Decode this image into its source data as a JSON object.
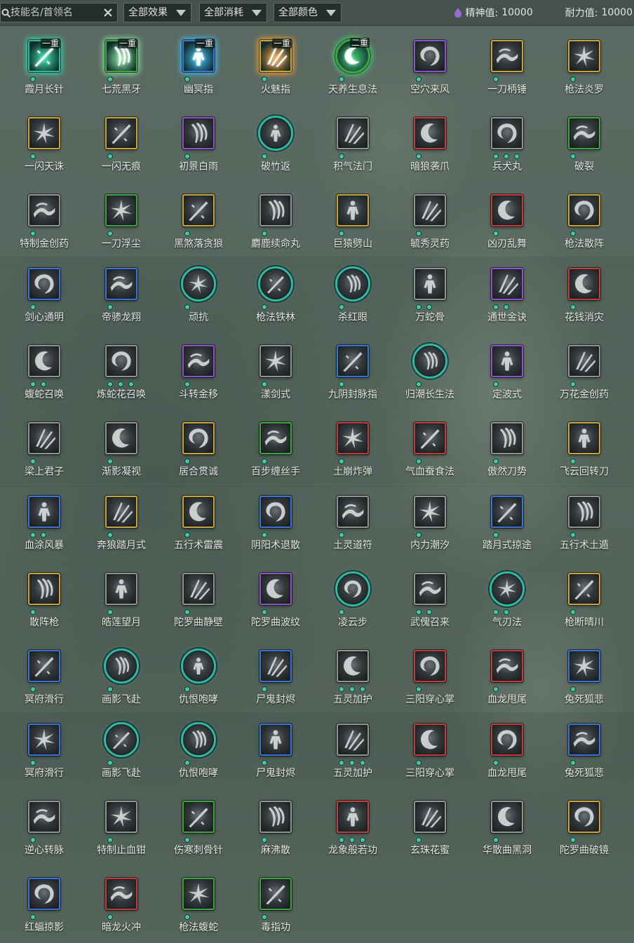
{
  "toolbar": {
    "search": {
      "placeholder": "技能名/首领名",
      "value": ""
    },
    "filters": [
      {
        "label": "全部效果"
      },
      {
        "label": "全部消耗"
      },
      {
        "label": "全部颜色"
      }
    ],
    "stats": [
      {
        "label": "精神值:",
        "value": "10000",
        "icon": "spirit-drop-icon",
        "icon_color": "#9a6bd8"
      },
      {
        "label": "耐力值:",
        "value": "10000",
        "icon": "stamina-crescent-icon",
        "icon_color": "#e3953c"
      }
    ]
  },
  "frame_colors": {
    "gold": "#c9a43a",
    "purple": "#8d52cc",
    "blue": "#3b74d6",
    "green": "#3fa540",
    "red": "#c43b3b",
    "grey": "#8e9593",
    "teal": "#2fb6a4"
  },
  "dot_color": "#44c9a5",
  "skills": [
    {
      "name": "霞月长针",
      "frame": "teal",
      "dots": 1,
      "badge": "一重",
      "glow": "#36e2b0"
    },
    {
      "name": "七荒黑牙",
      "frame": "green",
      "dots": 1,
      "badge": "一重",
      "glow": "#8ff0a8"
    },
    {
      "name": "幽冥指",
      "frame": "blue",
      "dots": 1,
      "badge": "一重",
      "glow": "#3fc4ff"
    },
    {
      "name": "火魅指",
      "frame": "gold",
      "dots": 1,
      "badge": "一重",
      "glow": "#ffa13a"
    },
    {
      "name": "天养生息法",
      "frame": "green",
      "dots": 1,
      "round": true,
      "badge": "二重",
      "glow": "#42d47a"
    },
    {
      "name": "空穴来风",
      "frame": "purple",
      "dots": 1
    },
    {
      "name": "一刀柄锤",
      "frame": "gold",
      "dots": 1
    },
    {
      "name": "枪法炎罗",
      "frame": "gold",
      "dots": 1
    },
    {
      "name": "一闪天诛",
      "frame": "gold",
      "dots": 1
    },
    {
      "name": "一闪无痕",
      "frame": "gold",
      "dots": 1
    },
    {
      "name": "初景白雨",
      "frame": "purple",
      "dots": 1
    },
    {
      "name": "破竹返",
      "frame": "teal",
      "dots": 1,
      "round": true
    },
    {
      "name": "积气法门",
      "frame": "grey",
      "dots": 1
    },
    {
      "name": "暗狼袭爪",
      "frame": "red",
      "dots": 1
    },
    {
      "name": "兵犬丸",
      "frame": "grey",
      "dots": 3
    },
    {
      "name": "破裂",
      "frame": "green",
      "dots": 1
    },
    {
      "name": "特制金创药",
      "frame": "grey",
      "dots": 1
    },
    {
      "name": "一刀浮尘",
      "frame": "green",
      "dots": 1
    },
    {
      "name": "黑煞落贪狼",
      "frame": "gold",
      "dots": 1
    },
    {
      "name": "麝鹿续命丸",
      "frame": "grey",
      "dots": 1
    },
    {
      "name": "巨猿劈山",
      "frame": "gold",
      "dots": 1
    },
    {
      "name": "毓秀灵药",
      "frame": "grey",
      "dots": 1
    },
    {
      "name": "凶刃乱舞",
      "frame": "red",
      "dots": 1
    },
    {
      "name": "枪法散阵",
      "frame": "gold",
      "dots": 1
    },
    {
      "name": "剑心通明",
      "frame": "blue",
      "dots": 1
    },
    {
      "name": "帝骖龙翔",
      "frame": "blue",
      "dots": 1
    },
    {
      "name": "顽抗",
      "frame": "teal",
      "dots": 1,
      "round": true
    },
    {
      "name": "枪法铁林",
      "frame": "teal",
      "dots": 1,
      "round": true
    },
    {
      "name": "杀红眼",
      "frame": "teal",
      "dots": 1,
      "round": true
    },
    {
      "name": "万蛇骨",
      "frame": "grey",
      "dots": 2
    },
    {
      "name": "通世金诀",
      "frame": "purple",
      "dots": 2
    },
    {
      "name": "花钱消灾",
      "frame": "red",
      "dots": 1
    },
    {
      "name": "蝮蛇召唤",
      "frame": "grey",
      "dots": 2
    },
    {
      "name": "炼蛇花召唤",
      "frame": "grey",
      "dots": 3
    },
    {
      "name": "斗转金移",
      "frame": "purple",
      "dots": 1
    },
    {
      "name": "漾剑式",
      "frame": "grey",
      "dots": 1
    },
    {
      "name": "九阴封脉指",
      "frame": "blue",
      "dots": 1
    },
    {
      "name": "归潮长生法",
      "frame": "teal",
      "dots": 1,
      "round": true
    },
    {
      "name": "定波式",
      "frame": "purple",
      "dots": 1
    },
    {
      "name": "万花金创药",
      "frame": "grey",
      "dots": 1
    },
    {
      "name": "梁上君子",
      "frame": "grey",
      "dots": 1
    },
    {
      "name": "渐影凝视",
      "frame": "grey",
      "dots": 1
    },
    {
      "name": "居合贯诚",
      "frame": "gold",
      "dots": 1
    },
    {
      "name": "百步缠丝手",
      "frame": "green",
      "dots": 1
    },
    {
      "name": "土崩炸弹",
      "frame": "red",
      "dots": 1
    },
    {
      "name": "气血蚕食法",
      "frame": "red",
      "dots": 1
    },
    {
      "name": "傲然刀势",
      "frame": "grey",
      "dots": 1
    },
    {
      "name": "飞云回转刀",
      "frame": "gold",
      "dots": 1
    },
    {
      "name": "血涂风暴",
      "frame": "blue",
      "dots": 2
    },
    {
      "name": "奔狼踏月式",
      "frame": "gold",
      "dots": 1
    },
    {
      "name": "五行术雷震",
      "frame": "gold",
      "dots": 1
    },
    {
      "name": "阴阳术退散",
      "frame": "blue",
      "dots": 1
    },
    {
      "name": "土灵道符",
      "frame": "grey",
      "dots": 1
    },
    {
      "name": "内力潮汐",
      "frame": "grey",
      "dots": 1
    },
    {
      "name": "踏月式掠途",
      "frame": "blue",
      "dots": 1
    },
    {
      "name": "五行术土遁",
      "frame": "grey",
      "dots": 1
    },
    {
      "name": "散阵枪",
      "frame": "gold",
      "dots": 1
    },
    {
      "name": "皓莲望月",
      "frame": "grey",
      "dots": 1
    },
    {
      "name": "陀罗曲静壁",
      "frame": "grey",
      "dots": 1
    },
    {
      "name": "陀罗曲波纹",
      "frame": "purple",
      "dots": 1
    },
    {
      "name": "凌云步",
      "frame": "teal",
      "dots": 1,
      "round": true
    },
    {
      "name": "武傀召来",
      "frame": "grey",
      "dots": 2
    },
    {
      "name": "气刃法",
      "frame": "teal",
      "dots": 2,
      "round": true
    },
    {
      "name": "枪断晴川",
      "frame": "gold",
      "dots": 1
    },
    {
      "name": "冥府滑行",
      "frame": "blue",
      "dots": 1
    },
    {
      "name": "画影飞赴",
      "frame": "teal",
      "dots": 1,
      "round": true
    },
    {
      "name": "仇恨咆哮",
      "frame": "teal",
      "dots": 1,
      "round": true
    },
    {
      "name": "尸鬼封烬",
      "frame": "blue",
      "dots": 1
    },
    {
      "name": "五灵加护",
      "frame": "grey",
      "dots": 3
    },
    {
      "name": "三阳穿心掌",
      "frame": "red",
      "dots": 1
    },
    {
      "name": "血龙甩尾",
      "frame": "red",
      "dots": 1
    },
    {
      "name": "兔死狐悲",
      "frame": "blue",
      "dots": 1
    },
    {
      "name": "冥府滑行",
      "frame": "blue",
      "dots": 1
    },
    {
      "name": "画影飞赴",
      "frame": "teal",
      "dots": 1,
      "round": true
    },
    {
      "name": "仇恨咆哮",
      "frame": "teal",
      "dots": 1,
      "round": true
    },
    {
      "name": "尸鬼封烬",
      "frame": "blue",
      "dots": 1
    },
    {
      "name": "五灵加护",
      "frame": "grey",
      "dots": 3
    },
    {
      "name": "三阳穿心掌",
      "frame": "red",
      "dots": 1
    },
    {
      "name": "血龙甩尾",
      "frame": "red",
      "dots": 1
    },
    {
      "name": "兔死狐悲",
      "frame": "blue",
      "dots": 1
    },
    {
      "name": "逆心转脉",
      "frame": "grey",
      "dots": 1
    },
    {
      "name": "特制止血钳",
      "frame": "grey",
      "dots": 1
    },
    {
      "name": "伤寒刺骨针",
      "frame": "green",
      "dots": 1
    },
    {
      "name": "麻沸散",
      "frame": "grey",
      "dots": 1
    },
    {
      "name": "龙象般若功",
      "frame": "red",
      "dots": 3
    },
    {
      "name": "玄珠花蜜",
      "frame": "grey",
      "dots": 1
    },
    {
      "name": "华散曲黑洞",
      "frame": "grey",
      "dots": 1
    },
    {
      "name": "陀罗曲破镜",
      "frame": "gold",
      "dots": 1
    },
    {
      "name": "红蝠掠影",
      "frame": "blue",
      "dots": 1
    },
    {
      "name": "暗龙火冲",
      "frame": "red",
      "dots": 1
    },
    {
      "name": "枪法蝮蛇",
      "frame": "green",
      "dots": 1
    },
    {
      "name": "毒指功",
      "frame": "green",
      "dots": 1
    }
  ]
}
